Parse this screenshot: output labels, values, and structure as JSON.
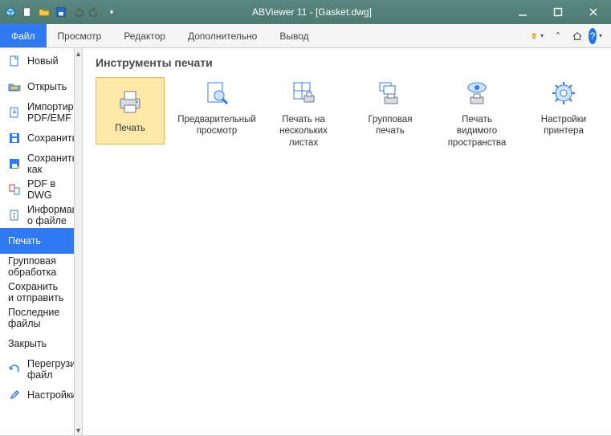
{
  "window": {
    "title": "ABViewer 11 - [Gasket.dwg]"
  },
  "qat": {
    "items": [
      {
        "name": "box-icon"
      },
      {
        "name": "new-icon"
      },
      {
        "name": "open-icon"
      },
      {
        "name": "save-icon"
      },
      {
        "name": "undo-icon"
      },
      {
        "name": "redo-icon"
      },
      {
        "name": "dropdown-icon"
      }
    ]
  },
  "menubar": {
    "items": [
      {
        "label": "Файл",
        "active": true
      },
      {
        "label": "Просмотр"
      },
      {
        "label": "Редактор"
      },
      {
        "label": "Дополнительно"
      },
      {
        "label": "Вывод"
      }
    ]
  },
  "topright": {
    "items": [
      {
        "name": "hand-up-icon"
      },
      {
        "name": "chevron-up-icon"
      },
      {
        "name": "home-icon"
      },
      {
        "name": "help-icon"
      }
    ]
  },
  "sidebar": {
    "items": [
      {
        "icon": "new-doc-icon",
        "label": "Новый"
      },
      {
        "icon": "open-icon",
        "label": "Открыть"
      },
      {
        "icon": "import-icon",
        "label": "Импортировать PDF/EMF"
      },
      {
        "icon": "save-icon",
        "label": "Сохранить"
      },
      {
        "icon": "saveas-icon",
        "label": "Сохранить как"
      },
      {
        "icon": "pdf2dwg-icon",
        "label": "PDF в DWG"
      },
      {
        "icon": "fileinfo-icon",
        "label": "Информация о файле"
      },
      {
        "icon": "",
        "label": "Печать",
        "active": true
      },
      {
        "icon": "",
        "label": "Групповая обработка"
      },
      {
        "icon": "",
        "label": "Сохранить и отправить"
      },
      {
        "icon": "",
        "label": "Последние файлы"
      },
      {
        "icon": "",
        "label": "Закрыть"
      },
      {
        "icon": "reload-icon",
        "label": "Перегрузить файл"
      },
      {
        "icon": "settings-icon",
        "label": "Настройки"
      }
    ]
  },
  "main": {
    "heading": "Инструменты печати",
    "tiles": [
      {
        "icon": "printer-icon",
        "label": "Печать",
        "selected": true
      },
      {
        "icon": "preview-icon",
        "label": "Предварительный просмотр"
      },
      {
        "icon": "print-sheets-icon",
        "label": "Печать на нескольких листах"
      },
      {
        "icon": "group-print-icon",
        "label": "Групповая печать"
      },
      {
        "icon": "print-visible-icon",
        "label": "Печать видимого пространства"
      },
      {
        "icon": "printer-settings-icon",
        "label": "Настройки принтера"
      }
    ]
  }
}
